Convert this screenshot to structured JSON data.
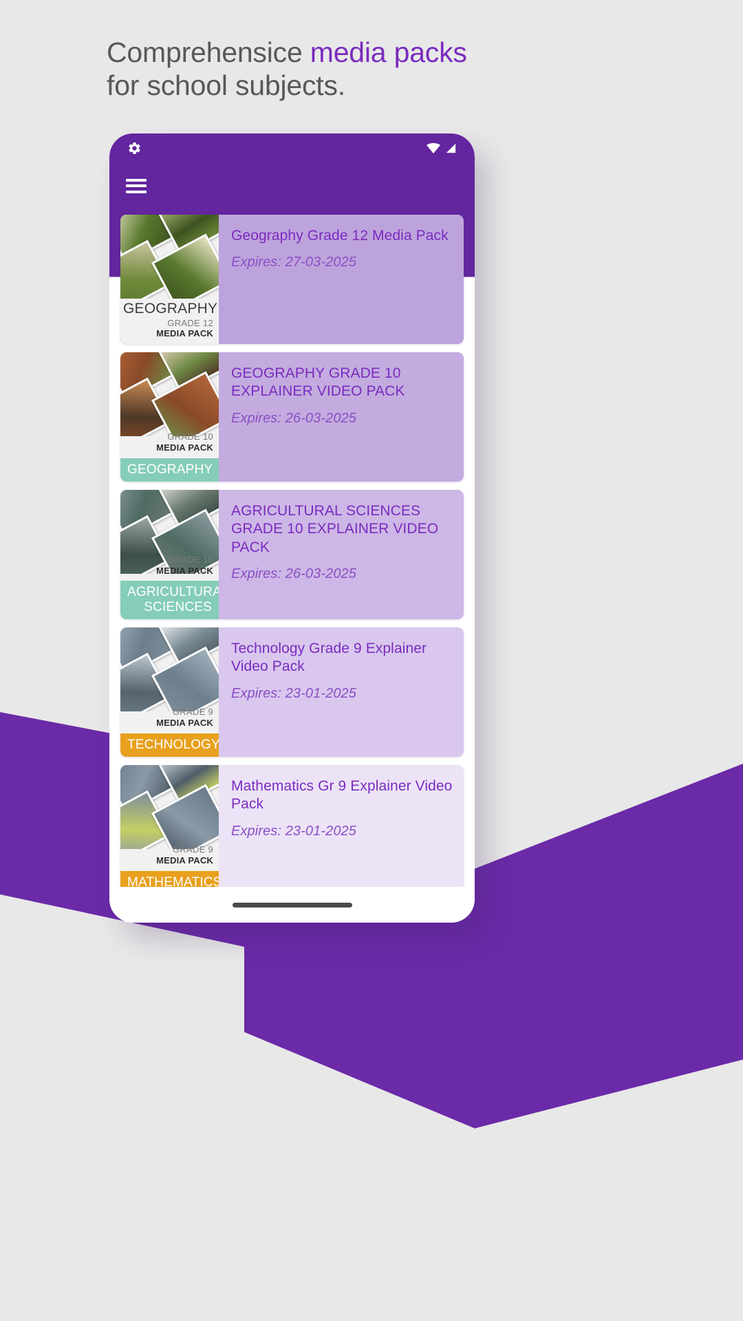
{
  "headline": {
    "line1_plain": "Comprehensice ",
    "line1_accent": "media packs",
    "line2": "for school subjects."
  },
  "colors": {
    "brand_purple": "#63269e",
    "accent_purple": "#7a2bbf",
    "teal_badge": "#85cdb8",
    "orange_badge": "#e8a01e",
    "page_bg": "#e8e8e8",
    "ribbon": "#6b2aa8"
  },
  "phone": {
    "status_bar": {
      "settings_icon": "gear-icon",
      "wifi_icon": "wifi-icon",
      "signal_icon": "cell-signal-icon"
    },
    "app_bar": {
      "menu_icon": "hamburger-menu-icon"
    },
    "home_indicator": "home-indicator"
  },
  "cards": [
    {
      "title": "Geography Grade 12 Media Pack",
      "expiry": "Expires: 27-03-2025",
      "thumb": {
        "subject_big": "GEOGRAPHY",
        "grade": "GRADE 12",
        "pack": "MEDIA PACK",
        "badge": "",
        "badge_color": "",
        "photo": "mountain-landscape-photo"
      },
      "card_bg": "#bda3dc"
    },
    {
      "title": "GEOGRAPHY GRADE 10 EXPLAINER VIDEO PACK",
      "expiry": "Expires: 26-03-2025",
      "thumb": {
        "subject_big": "",
        "grade": "GRADE 10",
        "pack": "MEDIA PACK",
        "badge": "GEOGRAPHY",
        "badge_color": "#85cdb8",
        "photo": "potted-plants-cart-photo"
      },
      "card_bg": "#c3abdf"
    },
    {
      "title": "AGRICULTURAL SCIENCES GRADE 10 EXPLAINER VIDEO PACK",
      "expiry": "Expires: 26-03-2025",
      "thumb": {
        "subject_big": "",
        "grade": "GRADE 10",
        "pack": "MEDIA PACK",
        "badge": "AGRICULTURAL SCIENCES",
        "badge_color": "#85cdb8",
        "photo": "farm-machinery-photo"
      },
      "card_bg": "#cdb7e6"
    },
    {
      "title": "Technology Grade 9 Explainer Video Pack",
      "expiry": "Expires: 23-01-2025",
      "thumb": {
        "subject_big": "",
        "grade": "GRADE 9",
        "pack": "MEDIA PACK",
        "badge": "TECHNOLOGY",
        "badge_color": "#e8a01e",
        "photo": "construction-site-photo"
      },
      "card_bg": "#d9c7ee"
    },
    {
      "title": "Mathematics Gr 9 Explainer Video Pack",
      "expiry": "Expires: 23-01-2025",
      "thumb": {
        "subject_big": "",
        "grade": "GRADE 9",
        "pack": "MEDIA PACK",
        "badge": "MATHEMATICS",
        "badge_color": "#e8a01e",
        "photo": "worker-pole-photo"
      },
      "card_bg": "#ece3f7"
    }
  ]
}
